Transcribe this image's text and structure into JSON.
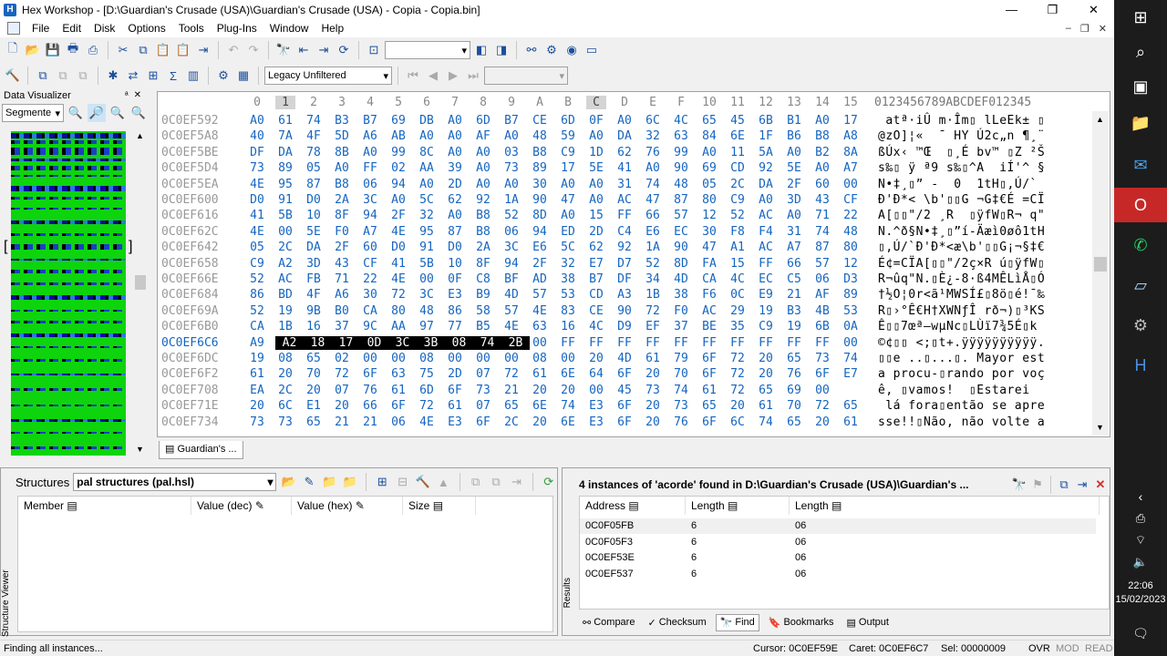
{
  "window": {
    "title": "Hex Workshop - [D:\\Guardian's Crusade (USA)\\Guardian's Crusade (USA) - Copia - Copia.bin]",
    "minimize": "—",
    "restore": "❐",
    "close": "✕",
    "mdi_min": "–",
    "mdi_restore": "❐",
    "mdi_close": "✕"
  },
  "menu": [
    "File",
    "Edit",
    "Disk",
    "Options",
    "Tools",
    "Plug-Ins",
    "Window",
    "Help"
  ],
  "toolbar2": {
    "filter_combo": "Legacy Unfiltered"
  },
  "data_visualizer": {
    "title": "Data Visualizer",
    "pin": "ᵃ",
    "mode_combo": "Segmente"
  },
  "hex": {
    "header_cols": [
      "0",
      "1",
      "2",
      "3",
      "4",
      "5",
      "6",
      "7",
      "8",
      "9",
      "A",
      "B",
      "C",
      "D",
      "E",
      "F",
      "10",
      "11",
      "12",
      "13",
      "14",
      "15"
    ],
    "ascii_header": "0123456789ABCDEF012345",
    "rows": [
      {
        "addr": "0C0EF592",
        "bytes": [
          "A0",
          "61",
          "74",
          "B3",
          "B7",
          "69",
          "DB",
          "A0",
          "6D",
          "B7",
          "CE",
          "6D",
          "0F",
          "A0",
          "6C",
          "4C",
          "65",
          "45",
          "6B",
          "B1",
          "A0",
          "17"
        ],
        "ascii": " atª·iÛ m·Îm▯ lLeEk± ▯"
      },
      {
        "addr": "0C0EF5A8",
        "bytes": [
          "40",
          "7A",
          "4F",
          "5D",
          "A6",
          "AB",
          "A0",
          "A0",
          "AF",
          "A0",
          "48",
          "59",
          "A0",
          "DA",
          "32",
          "63",
          "84",
          "6E",
          "1F",
          "B6",
          "B8",
          "A8"
        ],
        "ascii": "@zO]¦«  ¯ HY Ú2c„n ¶¸¨"
      },
      {
        "addr": "0C0EF5BE",
        "bytes": [
          "DF",
          "DA",
          "78",
          "8B",
          "A0",
          "99",
          "8C",
          "A0",
          "A0",
          "03",
          "B8",
          "C9",
          "1D",
          "62",
          "76",
          "99",
          "A0",
          "11",
          "5A",
          "A0",
          "B2",
          "8A"
        ],
        "ascii": "ßÚx‹ ™Œ  ▯¸É bv™ ▯Z ²Š"
      },
      {
        "addr": "0C0EF5D4",
        "bytes": [
          "73",
          "89",
          "05",
          "A0",
          "FF",
          "02",
          "AA",
          "39",
          "A0",
          "73",
          "89",
          "17",
          "5E",
          "41",
          "A0",
          "90",
          "69",
          "CD",
          "92",
          "5E",
          "A0",
          "A7"
        ],
        "ascii": "s‰▯ ÿ ª9 s‰▯^A  iÍ'^ §"
      },
      {
        "addr": "0C0EF5EA",
        "bytes": [
          "4E",
          "95",
          "87",
          "B8",
          "06",
          "94",
          "A0",
          "2D",
          "A0",
          "A0",
          "30",
          "A0",
          "A0",
          "31",
          "74",
          "48",
          "05",
          "2C",
          "DA",
          "2F",
          "60",
          "00"
        ],
        "ascii": "N•‡¸▯” -  0  1tH▯,Ú/`"
      },
      {
        "addr": "0C0EF600",
        "bytes": [
          "D0",
          "91",
          "D0",
          "2A",
          "3C",
          "A0",
          "5C",
          "62",
          "92",
          "1A",
          "90",
          "47",
          "A0",
          "AC",
          "47",
          "87",
          "80",
          "C9",
          "A0",
          "3D",
          "43",
          "CF"
        ],
        "ascii": "Đ'Đ*< \\b'▯▯G ¬G‡€É =CÏ"
      },
      {
        "addr": "0C0EF616",
        "bytes": [
          "41",
          "5B",
          "10",
          "8F",
          "94",
          "2F",
          "32",
          "A0",
          "B8",
          "52",
          "8D",
          "A0",
          "15",
          "FF",
          "66",
          "57",
          "12",
          "52",
          "AC",
          "A0",
          "71",
          "22"
        ],
        "ascii": "A[▯▯\"/2 ¸R  ▯ÿfW▯R¬ q\""
      },
      {
        "addr": "0C0EF62C",
        "bytes": [
          "4E",
          "00",
          "5E",
          "F0",
          "A7",
          "4E",
          "95",
          "87",
          "B8",
          "06",
          "94",
          "ED",
          "2D",
          "C4",
          "E6",
          "EC",
          "30",
          "F8",
          "F4",
          "31",
          "74",
          "48"
        ],
        "ascii": "N.^ð§N•‡¸▯”í-Äæì0øô1tH"
      },
      {
        "addr": "0C0EF642",
        "bytes": [
          "05",
          "2C",
          "DA",
          "2F",
          "60",
          "D0",
          "91",
          "D0",
          "2A",
          "3C",
          "E6",
          "5C",
          "62",
          "92",
          "1A",
          "90",
          "47",
          "A1",
          "AC",
          "A7",
          "87",
          "80"
        ],
        "ascii": "▯,Ú/`Đ'Đ*<æ\\b'▯▯G¡¬§‡€"
      },
      {
        "addr": "0C0EF658",
        "bytes": [
          "C9",
          "A2",
          "3D",
          "43",
          "CF",
          "41",
          "5B",
          "10",
          "8F",
          "94",
          "2F",
          "32",
          "E7",
          "D7",
          "52",
          "8D",
          "FA",
          "15",
          "FF",
          "66",
          "57",
          "12"
        ],
        "ascii": "É¢=CÏA[▯▯\"/2ç×R ú▯ÿfW▯"
      },
      {
        "addr": "0C0EF66E",
        "bytes": [
          "52",
          "AC",
          "FB",
          "71",
          "22",
          "4E",
          "00",
          "0F",
          "C8",
          "BF",
          "AD",
          "38",
          "B7",
          "DF",
          "34",
          "4D",
          "CA",
          "4C",
          "EC",
          "C5",
          "06",
          "D3"
        ],
        "ascii": "R¬ûq\"N.▯È¿-8·ß4MÊLìÅ▯Ó"
      },
      {
        "addr": "0C0EF684",
        "bytes": [
          "86",
          "BD",
          "4F",
          "A6",
          "30",
          "72",
          "3C",
          "E3",
          "B9",
          "4D",
          "57",
          "53",
          "CD",
          "A3",
          "1B",
          "38",
          "F6",
          "0C",
          "E9",
          "21",
          "AF",
          "89"
        ],
        "ascii": "†½O¦0r<ã¹MWSÍ£▯8ö▯é!¯‰"
      },
      {
        "addr": "0C0EF69A",
        "bytes": [
          "52",
          "19",
          "9B",
          "B0",
          "CA",
          "80",
          "48",
          "86",
          "58",
          "57",
          "4E",
          "83",
          "CE",
          "90",
          "72",
          "F0",
          "AC",
          "29",
          "19",
          "B3",
          "4B",
          "53"
        ],
        "ascii": "R▯›°Ê€H†XWNƒÎ rð¬)▯³KS"
      },
      {
        "addr": "0C0EF6B0",
        "bytes": [
          "CA",
          "1B",
          "16",
          "37",
          "9C",
          "AA",
          "97",
          "77",
          "B5",
          "4E",
          "63",
          "16",
          "4C",
          "D9",
          "EF",
          "37",
          "BE",
          "35",
          "C9",
          "19",
          "6B",
          "0A"
        ],
        "ascii": "Ê▯▯7œª—wµNc▯LÙï7¾5É▯k "
      },
      {
        "addr": "0C0EF6C6",
        "bytes": [
          "A9",
          "A2",
          "18",
          "17",
          "0D",
          "3C",
          "3B",
          "08",
          "74",
          "2B",
          "00",
          "FF",
          "FF",
          "FF",
          "FF",
          "FF",
          "FF",
          "FF",
          "FF",
          "FF",
          "FF",
          "00"
        ],
        "ascii": "©¢▯▯ <;▯t+.ÿÿÿÿÿÿÿÿÿÿ.",
        "selected": true
      },
      {
        "addr": "0C0EF6DC",
        "bytes": [
          "19",
          "08",
          "65",
          "02",
          "00",
          "00",
          "08",
          "00",
          "00",
          "00",
          "08",
          "00",
          "20",
          "4D",
          "61",
          "79",
          "6F",
          "72",
          "20",
          "65",
          "73",
          "74"
        ],
        "ascii": "▯▯e ..▯...▯. Mayor est"
      },
      {
        "addr": "0C0EF6F2",
        "bytes": [
          "61",
          "20",
          "70",
          "72",
          "6F",
          "63",
          "75",
          "2D",
          "07",
          "72",
          "61",
          "6E",
          "64",
          "6F",
          "20",
          "70",
          "6F",
          "72",
          "20",
          "76",
          "6F",
          "E7"
        ],
        "ascii": "a procu-▯rando por voç"
      },
      {
        "addr": "0C0EF708",
        "bytes": [
          "EA",
          "2C",
          "20",
          "07",
          "76",
          "61",
          "6D",
          "6F",
          "73",
          "21",
          "20",
          "20",
          "00",
          "45",
          "73",
          "74",
          "61",
          "72",
          "65",
          "69",
          "00"
        ],
        "ascii": "ê, ▯vamos!  ▯Estarei"
      },
      {
        "addr": "0C0EF71E",
        "bytes": [
          "20",
          "6C",
          "E1",
          "20",
          "66",
          "6F",
          "72",
          "61",
          "07",
          "65",
          "6E",
          "74",
          "E3",
          "6F",
          "20",
          "73",
          "65",
          "20",
          "61",
          "70",
          "72",
          "65"
        ],
        "ascii": " lá fora▯então se apre"
      },
      {
        "addr": "0C0EF734",
        "bytes": [
          "73",
          "73",
          "65",
          "21",
          "21",
          "06",
          "4E",
          "E3",
          "6F",
          "2C",
          "20",
          "6E",
          "E3",
          "6F",
          "20",
          "76",
          "6F",
          "6C",
          "74",
          "65",
          "20",
          "61"
        ],
        "ascii": "sse!!▯Não, não volte a"
      }
    ]
  },
  "document_tab": "Guardian's ...",
  "structures": {
    "label": "Structures",
    "combo": "pal structures (pal.hsl)",
    "columns": [
      "Member",
      "Value (dec)",
      "Value (hex)",
      "Size"
    ],
    "side_label": "Structure Viewer"
  },
  "results": {
    "title": "4 instances of 'acorde' found in D:\\Guardian's Crusade (USA)\\Guardian's ...",
    "columns": [
      "Address",
      "Length",
      "Length"
    ],
    "rows": [
      {
        "address": "0C0F05FB",
        "len_dec": "6",
        "len_hex": "06"
      },
      {
        "address": "0C0F05F3",
        "len_dec": "6",
        "len_hex": "06"
      },
      {
        "address": "0C0EF53E",
        "len_dec": "6",
        "len_hex": "06"
      },
      {
        "address": "0C0EF537",
        "len_dec": "6",
        "len_hex": "06"
      }
    ],
    "side_label": "Results",
    "tabs": [
      "Compare",
      "Checksum",
      "Find",
      "Bookmarks",
      "Output"
    ]
  },
  "status": {
    "message": "Finding all instances...",
    "cursor": "Cursor: 0C0EF59E",
    "caret": "Caret: 0C0EF6C7",
    "sel": "Sel: 00000009",
    "ovr": "OVR",
    "mod": "MOD",
    "read": "READ"
  },
  "taskbar": {
    "time": "22:06",
    "date": "15/02/2023"
  },
  "colors": {
    "hex_text": "#1565c0",
    "visualizer": "#0dd40d",
    "taskbar": "#1c1c1c"
  }
}
